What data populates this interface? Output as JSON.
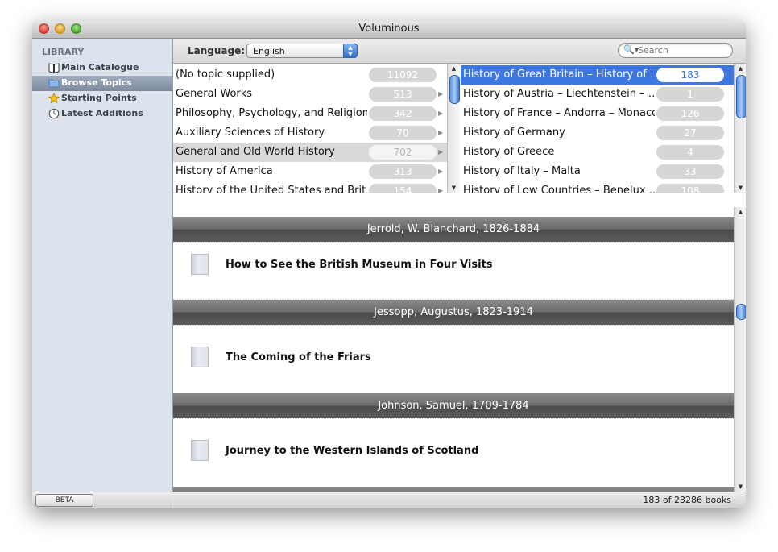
{
  "window": {
    "title": "Voluminous"
  },
  "sidebar": {
    "header": "LIBRARY",
    "items": [
      {
        "label": "Main Catalogue",
        "icon": "book-icon"
      },
      {
        "label": "Browse Topics",
        "icon": "folder-icon"
      },
      {
        "label": "Starting Points",
        "icon": "star-icon"
      },
      {
        "label": "Latest Additions",
        "icon": "clock-icon"
      }
    ],
    "beta_label": "BETA"
  },
  "toolbar": {
    "language_label": "Language:",
    "language_value": "English",
    "search_placeholder": "Search"
  },
  "topics": [
    {
      "name": "(No topic supplied)",
      "count": "11092"
    },
    {
      "name": "General Works",
      "count": "513"
    },
    {
      "name": "Philosophy, Psychology, and Religion",
      "count": "342"
    },
    {
      "name": "Auxiliary Sciences of History",
      "count": "70"
    },
    {
      "name": "General and Old World History",
      "count": "702"
    },
    {
      "name": "History of America",
      "count": "313"
    },
    {
      "name": "History of the United States and Brit…",
      "count": "154"
    }
  ],
  "subtopics": [
    {
      "name": "History of Great Britain – History of …",
      "count": "183"
    },
    {
      "name": "History of Austria – Liechtenstein – …",
      "count": "1"
    },
    {
      "name": "History of France – Andorra – Monaco",
      "count": "126"
    },
    {
      "name": "History of Germany",
      "count": "27"
    },
    {
      "name": "History of Greece",
      "count": "4"
    },
    {
      "name": "History of Italy – Malta",
      "count": "33"
    },
    {
      "name": "History of Low Countries – Benelux …",
      "count": "108"
    }
  ],
  "results": [
    {
      "author": "Jerrold, W. Blanchard, 1826-1884",
      "book": "How to See the British Museum in Four Visits"
    },
    {
      "author": "Jessopp, Augustus, 1823-1914",
      "book": "The Coming of the Friars"
    },
    {
      "author": "Johnson, Samuel, 1709-1784",
      "book": "Journey to the Western Islands of Scotland"
    }
  ],
  "status": {
    "text": "183 of 23286 books"
  },
  "colors": {
    "selection": "#3c78e0",
    "sidebar": "#dce3ec",
    "author_bar": "#5a5a5a"
  }
}
